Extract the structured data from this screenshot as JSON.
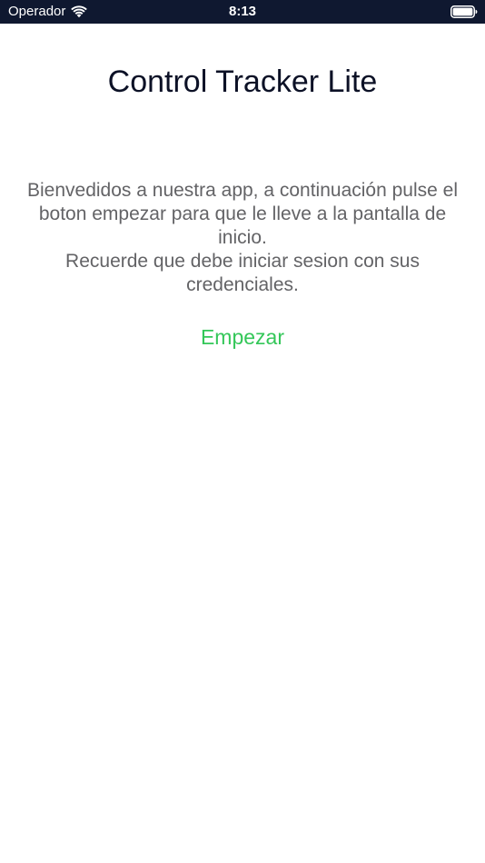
{
  "status_bar": {
    "carrier": "Operador",
    "time": "8:13",
    "wifi_icon": "wifi-icon",
    "battery_icon": "battery-full-icon"
  },
  "app": {
    "title": "Control Tracker Lite"
  },
  "welcome": {
    "paragraph_1": "Bienvedidos a nuestra app, a continuación pulse el boton empezar para que le lleve a la pantalla de inicio.",
    "paragraph_2": "Recuerde que debe iniciar sesion con sus credenciales."
  },
  "actions": {
    "start_label": "Empezar"
  },
  "colors": {
    "status_bar_bg": "#0f1830",
    "title": "#0c1126",
    "body_text": "#636366",
    "accent_green": "#34c759"
  }
}
